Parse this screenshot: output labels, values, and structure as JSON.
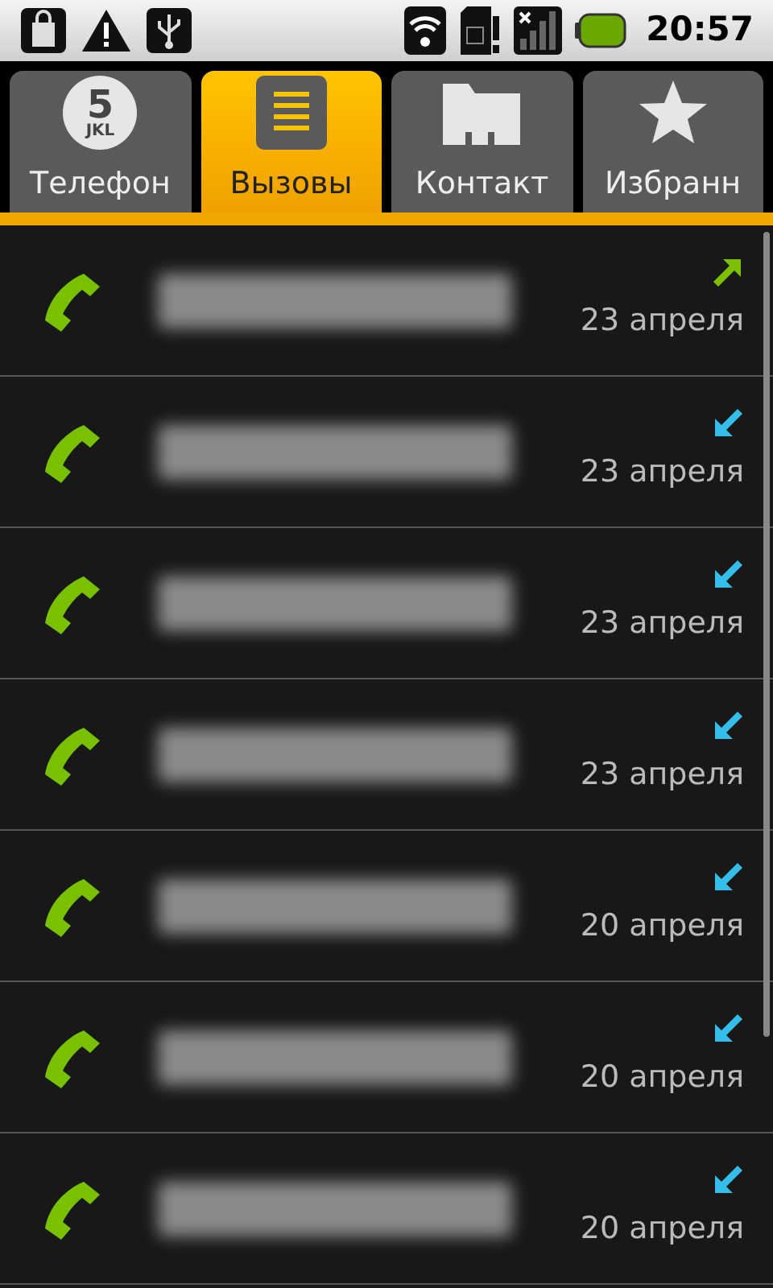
{
  "status_bar": {
    "time": "20:57"
  },
  "tabs": [
    {
      "label": "Телефон",
      "kind": "dialpad",
      "key_digit": "5",
      "key_letters": "JKL",
      "selected": false
    },
    {
      "label": "Вызовы",
      "kind": "calllog",
      "selected": true
    },
    {
      "label": "Контакт",
      "kind": "contacts",
      "selected": false
    },
    {
      "label": "Избранн",
      "kind": "favorites",
      "selected": false
    }
  ],
  "calls": [
    {
      "kind": "outgoing",
      "date": "23 апреля"
    },
    {
      "kind": "incoming",
      "date": "23 апреля"
    },
    {
      "kind": "incoming",
      "date": "23 апреля"
    },
    {
      "kind": "incoming",
      "date": "23 апреля"
    },
    {
      "kind": "incoming",
      "date": "20 апреля"
    },
    {
      "kind": "incoming",
      "date": "20 апреля"
    },
    {
      "kind": "incoming",
      "date": "20 апреля"
    }
  ]
}
